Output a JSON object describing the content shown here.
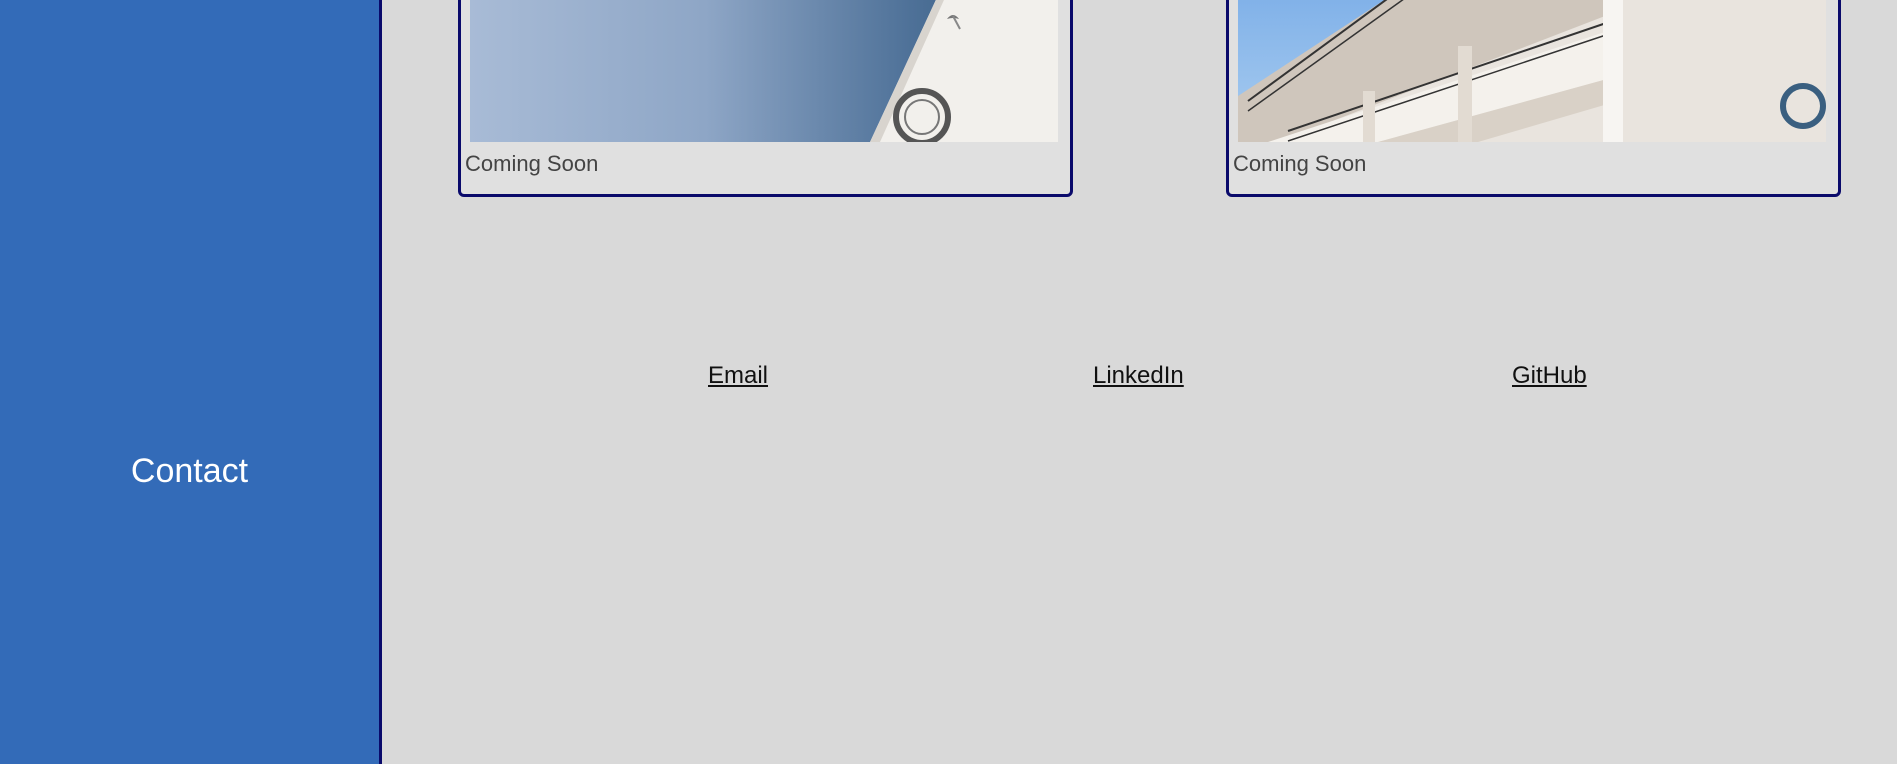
{
  "sidebar": {
    "label": "Contact",
    "color": "#336bb8"
  },
  "projects": [
    {
      "caption": "Coming Soon",
      "image_icon": "building-photo-icon"
    },
    {
      "caption": "Coming Soon",
      "image_icon": "balcony-photo-icon"
    }
  ],
  "contact_links": {
    "email": "Email",
    "linkedin": "LinkedIn",
    "github": "GitHub"
  },
  "colors": {
    "background": "#d9d9d9",
    "border": "#0a0a6b"
  }
}
